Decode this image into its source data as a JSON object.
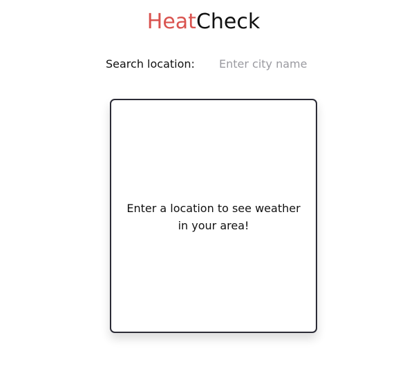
{
  "app": {
    "title_part1": "Heat",
    "title_part2": "Check",
    "colors": {
      "accent": "#d9534f",
      "text": "#111111",
      "card_border": "#2b2b36",
      "placeholder": "#9a9aa0"
    }
  },
  "search": {
    "label": "Search location:",
    "placeholder": "Enter city name",
    "value": ""
  },
  "card": {
    "message": "Enter a location to see weather in your area!"
  }
}
